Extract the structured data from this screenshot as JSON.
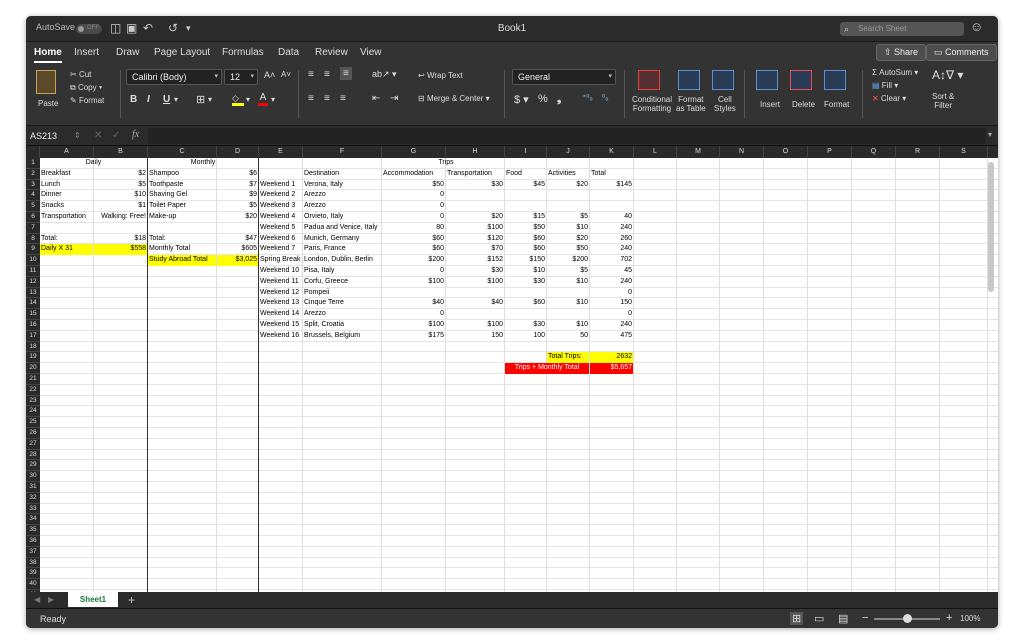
{
  "app": {
    "title": "Book1",
    "autosave": "AutoSave",
    "autosave_state": "OFF",
    "search_placeholder": "Search Sheet"
  },
  "menu": {
    "tabs": [
      "Home",
      "Insert",
      "Draw",
      "Page Layout",
      "Formulas",
      "Data",
      "Review",
      "View"
    ],
    "share": "Share",
    "comments": "Comments"
  },
  "ribbon": {
    "cut": "Cut",
    "copy": "Copy",
    "format": "Format",
    "paste": "Paste",
    "font": "Calibri (Body)",
    "size": "12",
    "wrap": "Wrap Text",
    "merge": "Merge & Center",
    "number_format": "General",
    "cond1": "Conditional",
    "cond2": "Formatting",
    "fat1": "Format",
    "fat2": "as Table",
    "cs1": "Cell",
    "cs2": "Styles",
    "insert": "Insert",
    "delete": "Delete",
    "format2": "Format",
    "autosum": "AutoSum",
    "fill": "Fill",
    "clear": "Clear",
    "sort1": "Sort &",
    "sort2": "Filter"
  },
  "formula": {
    "namebox": "AS213",
    "fx": "fx"
  },
  "sheet": {
    "tab": "Sheet1",
    "status": "Ready",
    "zoom": "100%",
    "zoom_level": 0.5
  },
  "columns": [
    "A",
    "B",
    "C",
    "D",
    "E",
    "F",
    "G",
    "H",
    "I",
    "J",
    "K",
    "L",
    "M",
    "N",
    "O",
    "P",
    "Q",
    "R",
    "S"
  ],
  "rows": 41,
  "cells": [
    {
      "c": "A",
      "r": 1,
      "v": "Daily",
      "a": "center",
      "span": 2
    },
    {
      "c": "C",
      "r": 1,
      "v": "Monthly",
      "a": "center",
      "span": 2
    },
    {
      "c": "E",
      "r": 1,
      "v": "Trips",
      "a": "center",
      "span": 7
    },
    {
      "c": "A",
      "r": 2,
      "v": "Breakfast"
    },
    {
      "c": "B",
      "r": 2,
      "v": "$2",
      "a": "right"
    },
    {
      "c": "C",
      "r": 2,
      "v": "Shampoo"
    },
    {
      "c": "D",
      "r": 2,
      "v": "$6",
      "a": "right"
    },
    {
      "c": "F",
      "r": 2,
      "v": "Destination"
    },
    {
      "c": "G",
      "r": 2,
      "v": "Accommodation"
    },
    {
      "c": "H",
      "r": 2,
      "v": "Transportation"
    },
    {
      "c": "I",
      "r": 2,
      "v": "Food"
    },
    {
      "c": "J",
      "r": 2,
      "v": "Activities"
    },
    {
      "c": "K",
      "r": 2,
      "v": "Total"
    },
    {
      "c": "A",
      "r": 3,
      "v": "Lunch"
    },
    {
      "c": "B",
      "r": 3,
      "v": "$5",
      "a": "right"
    },
    {
      "c": "C",
      "r": 3,
      "v": "Toothpaste"
    },
    {
      "c": "D",
      "r": 3,
      "v": "$7",
      "a": "right"
    },
    {
      "c": "E",
      "r": 3,
      "v": "Weekend 1"
    },
    {
      "c": "F",
      "r": 3,
      "v": "Verona, Italy"
    },
    {
      "c": "G",
      "r": 3,
      "v": "$50",
      "a": "right"
    },
    {
      "c": "H",
      "r": 3,
      "v": "$30",
      "a": "right"
    },
    {
      "c": "I",
      "r": 3,
      "v": "$45",
      "a": "right"
    },
    {
      "c": "J",
      "r": 3,
      "v": "$20",
      "a": "right"
    },
    {
      "c": "K",
      "r": 3,
      "v": "$145",
      "a": "right"
    },
    {
      "c": "A",
      "r": 4,
      "v": "Dinner"
    },
    {
      "c": "B",
      "r": 4,
      "v": "$10",
      "a": "right"
    },
    {
      "c": "C",
      "r": 4,
      "v": "Shaving Gel"
    },
    {
      "c": "D",
      "r": 4,
      "v": "$9",
      "a": "right"
    },
    {
      "c": "E",
      "r": 4,
      "v": "Weekend 2"
    },
    {
      "c": "F",
      "r": 4,
      "v": "Arezzo"
    },
    {
      "c": "G",
      "r": 4,
      "v": "0",
      "a": "right"
    },
    {
      "c": "A",
      "r": 5,
      "v": "Snacks"
    },
    {
      "c": "B",
      "r": 5,
      "v": "$1",
      "a": "right"
    },
    {
      "c": "C",
      "r": 5,
      "v": "Toilet Paper"
    },
    {
      "c": "D",
      "r": 5,
      "v": "$5",
      "a": "right"
    },
    {
      "c": "E",
      "r": 5,
      "v": "Weekend 3"
    },
    {
      "c": "F",
      "r": 5,
      "v": "Arezzo"
    },
    {
      "c": "G",
      "r": 5,
      "v": "0",
      "a": "right"
    },
    {
      "c": "A",
      "r": 6,
      "v": "Transportation"
    },
    {
      "c": "B",
      "r": 6,
      "v": "Walking: Free!",
      "a": "right"
    },
    {
      "c": "C",
      "r": 6,
      "v": "Make-up"
    },
    {
      "c": "D",
      "r": 6,
      "v": "$20",
      "a": "right"
    },
    {
      "c": "E",
      "r": 6,
      "v": "Weekend 4"
    },
    {
      "c": "F",
      "r": 6,
      "v": "Orvieto, Italy"
    },
    {
      "c": "G",
      "r": 6,
      "v": "0",
      "a": "right"
    },
    {
      "c": "H",
      "r": 6,
      "v": "$20",
      "a": "right"
    },
    {
      "c": "I",
      "r": 6,
      "v": "$15",
      "a": "right"
    },
    {
      "c": "J",
      "r": 6,
      "v": "$5",
      "a": "right"
    },
    {
      "c": "K",
      "r": 6,
      "v": "40",
      "a": "right"
    },
    {
      "c": "E",
      "r": 7,
      "v": "Weekend 5"
    },
    {
      "c": "F",
      "r": 7,
      "v": "Padua and Venice, Italy"
    },
    {
      "c": "G",
      "r": 7,
      "v": "80",
      "a": "right"
    },
    {
      "c": "H",
      "r": 7,
      "v": "$100",
      "a": "right"
    },
    {
      "c": "I",
      "r": 7,
      "v": "$50",
      "a": "right"
    },
    {
      "c": "J",
      "r": 7,
      "v": "$10",
      "a": "right"
    },
    {
      "c": "K",
      "r": 7,
      "v": "240",
      "a": "right"
    },
    {
      "c": "A",
      "r": 8,
      "v": "Total:"
    },
    {
      "c": "B",
      "r": 8,
      "v": "$18",
      "a": "right"
    },
    {
      "c": "C",
      "r": 8,
      "v": "Total:"
    },
    {
      "c": "D",
      "r": 8,
      "v": "$47",
      "a": "right"
    },
    {
      "c": "E",
      "r": 8,
      "v": "Weekend 6"
    },
    {
      "c": "F",
      "r": 8,
      "v": "Munich, Germany"
    },
    {
      "c": "G",
      "r": 8,
      "v": "$60",
      "a": "right"
    },
    {
      "c": "H",
      "r": 8,
      "v": "$120",
      "a": "right"
    },
    {
      "c": "I",
      "r": 8,
      "v": "$60",
      "a": "right"
    },
    {
      "c": "J",
      "r": 8,
      "v": "$20",
      "a": "right"
    },
    {
      "c": "K",
      "r": 8,
      "v": "260",
      "a": "right"
    },
    {
      "c": "A",
      "r": 9,
      "v": "Daily X 31",
      "bg": "#ffff00"
    },
    {
      "c": "B",
      "r": 9,
      "v": "$558",
      "a": "right",
      "bg": "#ffff00"
    },
    {
      "c": "C",
      "r": 9,
      "v": "Monthly Total"
    },
    {
      "c": "D",
      "r": 9,
      "v": "$605",
      "a": "right"
    },
    {
      "c": "E",
      "r": 9,
      "v": "Weekend 7"
    },
    {
      "c": "F",
      "r": 9,
      "v": "Paris, France"
    },
    {
      "c": "G",
      "r": 9,
      "v": "$60",
      "a": "right"
    },
    {
      "c": "H",
      "r": 9,
      "v": "$70",
      "a": "right"
    },
    {
      "c": "I",
      "r": 9,
      "v": "$60",
      "a": "right"
    },
    {
      "c": "J",
      "r": 9,
      "v": "$50",
      "a": "right"
    },
    {
      "c": "K",
      "r": 9,
      "v": "240",
      "a": "right"
    },
    {
      "c": "C",
      "r": 10,
      "v": "Study Abroad Total",
      "bg": "#ffff00"
    },
    {
      "c": "D",
      "r": 10,
      "v": "$3,025",
      "a": "right",
      "bg": "#ffff00"
    },
    {
      "c": "E",
      "r": 10,
      "v": "Spring Break"
    },
    {
      "c": "F",
      "r": 10,
      "v": "London, Dublin, Berlin"
    },
    {
      "c": "G",
      "r": 10,
      "v": "$200",
      "a": "right"
    },
    {
      "c": "H",
      "r": 10,
      "v": "$152",
      "a": "right"
    },
    {
      "c": "I",
      "r": 10,
      "v": "$150",
      "a": "right"
    },
    {
      "c": "J",
      "r": 10,
      "v": "$200",
      "a": "right"
    },
    {
      "c": "K",
      "r": 10,
      "v": "702",
      "a": "right"
    },
    {
      "c": "E",
      "r": 11,
      "v": "Weekend 10"
    },
    {
      "c": "F",
      "r": 11,
      "v": "Pisa, Italy"
    },
    {
      "c": "G",
      "r": 11,
      "v": "0",
      "a": "right"
    },
    {
      "c": "H",
      "r": 11,
      "v": "$30",
      "a": "right"
    },
    {
      "c": "I",
      "r": 11,
      "v": "$10",
      "a": "right"
    },
    {
      "c": "J",
      "r": 11,
      "v": "$5",
      "a": "right"
    },
    {
      "c": "K",
      "r": 11,
      "v": "45",
      "a": "right"
    },
    {
      "c": "E",
      "r": 12,
      "v": "Weekend 11"
    },
    {
      "c": "F",
      "r": 12,
      "v": "Corfu, Greece"
    },
    {
      "c": "G",
      "r": 12,
      "v": "$100",
      "a": "right"
    },
    {
      "c": "H",
      "r": 12,
      "v": "$100",
      "a": "right"
    },
    {
      "c": "I",
      "r": 12,
      "v": "$30",
      "a": "right"
    },
    {
      "c": "J",
      "r": 12,
      "v": "$10",
      "a": "right"
    },
    {
      "c": "K",
      "r": 12,
      "v": "240",
      "a": "right"
    },
    {
      "c": "E",
      "r": 13,
      "v": "Weekend 12"
    },
    {
      "c": "F",
      "r": 13,
      "v": "Pompeii"
    },
    {
      "c": "K",
      "r": 13,
      "v": "0",
      "a": "right"
    },
    {
      "c": "E",
      "r": 14,
      "v": "Weekend 13"
    },
    {
      "c": "F",
      "r": 14,
      "v": "Cinque Terre"
    },
    {
      "c": "G",
      "r": 14,
      "v": "$40",
      "a": "right"
    },
    {
      "c": "H",
      "r": 14,
      "v": "$40",
      "a": "right"
    },
    {
      "c": "I",
      "r": 14,
      "v": "$60",
      "a": "right"
    },
    {
      "c": "J",
      "r": 14,
      "v": "$10",
      "a": "right"
    },
    {
      "c": "K",
      "r": 14,
      "v": "150",
      "a": "right"
    },
    {
      "c": "E",
      "r": 15,
      "v": "Weekend 14"
    },
    {
      "c": "F",
      "r": 15,
      "v": "Arezzo"
    },
    {
      "c": "G",
      "r": 15,
      "v": "0",
      "a": "right"
    },
    {
      "c": "K",
      "r": 15,
      "v": "0",
      "a": "right"
    },
    {
      "c": "E",
      "r": 16,
      "v": "Weekend 15"
    },
    {
      "c": "F",
      "r": 16,
      "v": "Split, Croatia"
    },
    {
      "c": "G",
      "r": 16,
      "v": "$100",
      "a": "right"
    },
    {
      "c": "H",
      "r": 16,
      "v": "$100",
      "a": "right"
    },
    {
      "c": "I",
      "r": 16,
      "v": "$30",
      "a": "right"
    },
    {
      "c": "J",
      "r": 16,
      "v": "$10",
      "a": "right"
    },
    {
      "c": "K",
      "r": 16,
      "v": "240",
      "a": "right"
    },
    {
      "c": "E",
      "r": 17,
      "v": "Weekend 16"
    },
    {
      "c": "F",
      "r": 17,
      "v": "Brussels, Belgium"
    },
    {
      "c": "G",
      "r": 17,
      "v": "$175",
      "a": "right"
    },
    {
      "c": "H",
      "r": 17,
      "v": "150",
      "a": "right"
    },
    {
      "c": "I",
      "r": 17,
      "v": "100",
      "a": "right"
    },
    {
      "c": "J",
      "r": 17,
      "v": "50",
      "a": "right"
    },
    {
      "c": "K",
      "r": 17,
      "v": "475",
      "a": "right"
    },
    {
      "c": "J",
      "r": 19,
      "v": "Total Trips:",
      "bg": "#ffff00"
    },
    {
      "c": "K",
      "r": 19,
      "v": "2632",
      "a": "right",
      "bg": "#ffff00"
    },
    {
      "c": "I",
      "r": 20,
      "v": "Trips + Monthly Total",
      "span": 2,
      "bg": "#ff0000",
      "fg": "#ffffff",
      "a": "center"
    },
    {
      "c": "K",
      "r": 20,
      "v": "$5,657",
      "a": "right",
      "bg": "#ff0000",
      "fg": "#ffffff"
    }
  ]
}
